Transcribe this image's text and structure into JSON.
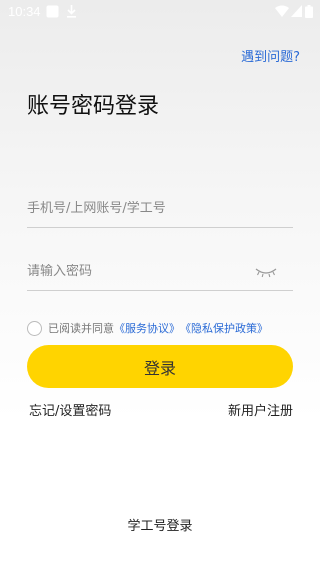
{
  "status_bar": {
    "time": "10:34"
  },
  "help_link": "遇到问题?",
  "title": "账号密码登录",
  "account_field": {
    "placeholder": "手机号/上网账号/学工号",
    "value": ""
  },
  "password_field": {
    "placeholder": "请输入密码",
    "value": ""
  },
  "agreement": {
    "prefix": "已阅读并同意",
    "service_link": "《服务协议》",
    "privacy_link": "《隐私保护政策》"
  },
  "login_button": "登录",
  "forgot_password": "忘记/设置密码",
  "register": "新用户注册",
  "alt_login": "学工号登录",
  "colors": {
    "accent": "#ffd400",
    "link": "#2b6bd6"
  },
  "icons": [
    "image-icon",
    "download-icon",
    "wifi-icon",
    "signal-icon",
    "battery-icon",
    "eye-closed-icon"
  ]
}
